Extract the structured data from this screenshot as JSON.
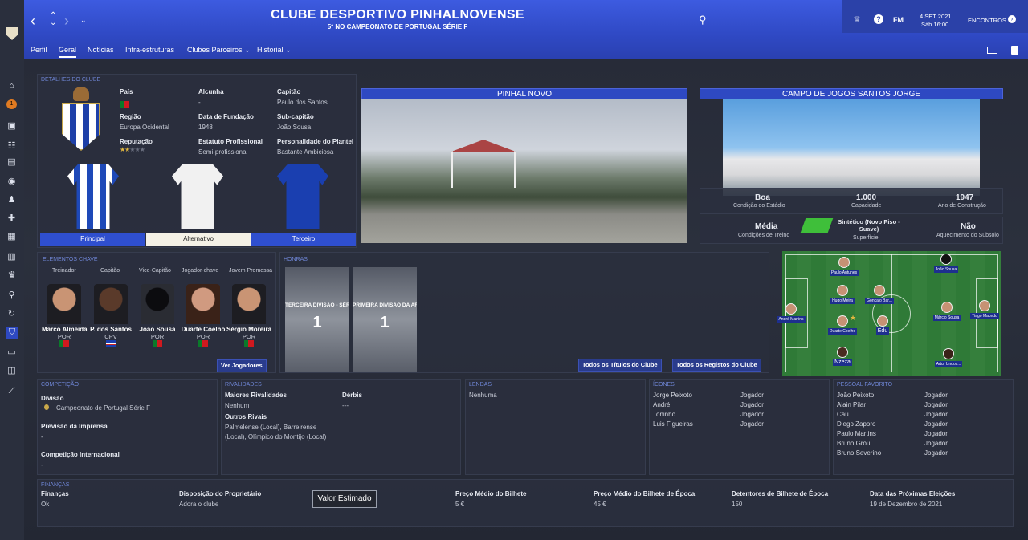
{
  "header": {
    "club_name": "CLUBE DESPORTIVO PINHALNOVENSE",
    "subtitle": "5º NO CAMPEONATO DE PORTUGAL SÉRIE F",
    "date": "4 SET 2021",
    "day_time": "Sáb 16:00",
    "continue_label": "ENCONTROS",
    "fm_label": "FM",
    "help_label": "?"
  },
  "tabs": [
    {
      "label": "Perfil"
    },
    {
      "label": "Geral"
    },
    {
      "label": "Notícias"
    },
    {
      "label": "Infra-estruturas"
    },
    {
      "label": "Clubes Parceiros"
    },
    {
      "label": "Historial"
    }
  ],
  "club_details": {
    "section": "DETALHES DO CLUBE",
    "country_label": "País",
    "region_label": "Região",
    "region_value": "Europa Ocidental",
    "reputation_label": "Reputação",
    "reputation_stars": 2,
    "nickname_label": "Alcunha",
    "nickname_value": "-",
    "founded_label": "Data de Fundação",
    "founded_value": "1948",
    "status_label": "Estatuto Profissional",
    "status_value": "Semi-profissional",
    "captain_label": "Capitão",
    "captain_value": "Paulo dos Santos",
    "vice_label": "Sub-capitão",
    "vice_value": "João Sousa",
    "personality_label": "Personalidade do Plantel",
    "personality_value": "Bastante Ambiciosa",
    "kits": [
      "Principal",
      "Alternativo",
      "Terceiro"
    ]
  },
  "photos": {
    "city": "PINHAL NOVO",
    "stadium": "CAMPO DE JOGOS SANTOS JORGE"
  },
  "stadium_stats": {
    "condition_value": "Boa",
    "condition_label": "Condição do Estádio",
    "capacity_value": "1.000",
    "capacity_label": "Capacidade",
    "built_value": "1947",
    "built_label": "Ano de Construção",
    "training_value": "Média",
    "training_label": "Condições de Treino",
    "surface_value": "Sintético (Novo Piso - Suave)",
    "surface_label": "Superfície",
    "heating_value": "Não",
    "heating_label": "Aquecimento do Subsolo"
  },
  "key_people": {
    "section": "ELEMENTOS CHAVE",
    "roles": [
      "Treinador",
      "Capitão",
      "Vice-Capitão",
      "Jogador-chave",
      "Jovem Promessa"
    ],
    "people": [
      {
        "name": "Marco Almeida",
        "nat": "POR"
      },
      {
        "name": "P. dos Santos",
        "nat": "CPV"
      },
      {
        "name": "João Sousa",
        "nat": "POR"
      },
      {
        "name": "Duarte Coelho",
        "nat": "POR"
      },
      {
        "name": "Sérgio Moreira",
        "nat": "POR"
      }
    ],
    "button": "Ver Jogadores"
  },
  "honours": {
    "section": "HONRAS",
    "items": [
      {
        "title": "TERCEIRA DIVISÃO - SÉRIE F",
        "count": "1"
      },
      {
        "title": "PRIMEIRA DIVISÃO DA AF SE...",
        "count": "1"
      }
    ],
    "btn_titles": "Todos os Títulos do Clube",
    "btn_records": "Todos os Registos do Clube"
  },
  "lineup": [
    {
      "name": "Paulo Antunes"
    },
    {
      "name": "João Sousa"
    },
    {
      "name": "Hugo Meira"
    },
    {
      "name": "Gonçalo Bar..."
    },
    {
      "name": "André Martins"
    },
    {
      "name": "Márcio Sousa"
    },
    {
      "name": "Tiago Macedo"
    },
    {
      "name": "Duarte Coelho"
    },
    {
      "name": "Edu"
    },
    {
      "name": "Nzeza"
    },
    {
      "name": "Artur Undos..."
    }
  ],
  "competition": {
    "section": "COMPETIÇÃO",
    "division_label": "Divisão",
    "division_value": "Campeonato de Portugal Série F",
    "press_label": "Previsão da Imprensa",
    "press_value": "-",
    "intl_label": "Competição Internacional",
    "intl_value": "-"
  },
  "rivalries": {
    "section": "RIVALIDADES",
    "main_label": "Maiores Rivalidades",
    "main_value": "Nenhum",
    "derby_label": "Dérbis",
    "derby_value": "---",
    "others_label": "Outros Rivais",
    "others_line1": "Palmelense (Local), Barreirense",
    "others_line2": "(Local), Olímpico do Montijo (Local)"
  },
  "legends": {
    "section": "LENDAS",
    "value": "Nenhuma"
  },
  "icons": {
    "section": "ÍCONES",
    "rows": [
      {
        "name": "Jorge Peixoto",
        "role": "Jogador"
      },
      {
        "name": "André",
        "role": "Jogador"
      },
      {
        "name": "Toninho",
        "role": "Jogador"
      },
      {
        "name": "Luis Figueiras",
        "role": "Jogador"
      }
    ]
  },
  "favourites": {
    "section": "PESSOAL FAVORITO",
    "rows": [
      {
        "name": "João Peixoto",
        "role": "Jogador"
      },
      {
        "name": "Alain Pilar",
        "role": "Jogador"
      },
      {
        "name": "Cau",
        "role": "Jogador"
      },
      {
        "name": "Diego Zaporo",
        "role": "Jogador"
      },
      {
        "name": "Paulo Martins",
        "role": "Jogador"
      },
      {
        "name": "Bruno Grou",
        "role": "Jogador"
      },
      {
        "name": "Bruno Severino",
        "role": "Jogador"
      }
    ]
  },
  "finances": {
    "section": "FINANÇAS",
    "fin_label": "Finanças",
    "fin_value": "Ok",
    "owner_label": "Disposição do Proprietário",
    "owner_value": "Adora o clube",
    "tooltip": "Valor Estimado",
    "ticket_label": "Preço Médio do Bilhete",
    "ticket_value": "5 €",
    "season_label": "Preço Médio do Bilhete de Época",
    "season_value": "45 €",
    "holders_label": "Detentores de Bilhete de Época",
    "holders_value": "150",
    "election_label": "Data das Próximas Eleições",
    "election_value": "19 de Dezembro de 2021"
  }
}
